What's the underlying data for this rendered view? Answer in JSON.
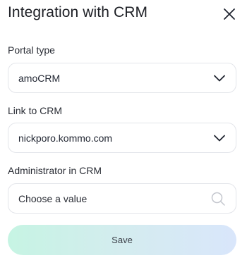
{
  "modal": {
    "title": "Integration with CRM",
    "close_icon": "close-icon"
  },
  "fields": {
    "portal_type": {
      "label": "Portal type",
      "value": "amoCRM",
      "icon": "chevron-down-icon"
    },
    "link_to_crm": {
      "label": "Link to CRM",
      "value": "nickporo.kommo.com",
      "icon": "chevron-down-icon"
    },
    "administrator": {
      "label": "Administrator in CRM",
      "placeholder": "Choose a value",
      "icon": "search-icon"
    }
  },
  "actions": {
    "save_label": "Save"
  },
  "colors": {
    "border": "#e3e5ea",
    "save_gradient_start": "#c6f4e3",
    "save_gradient_end": "#d9e6fb",
    "text": "#1f2430"
  }
}
